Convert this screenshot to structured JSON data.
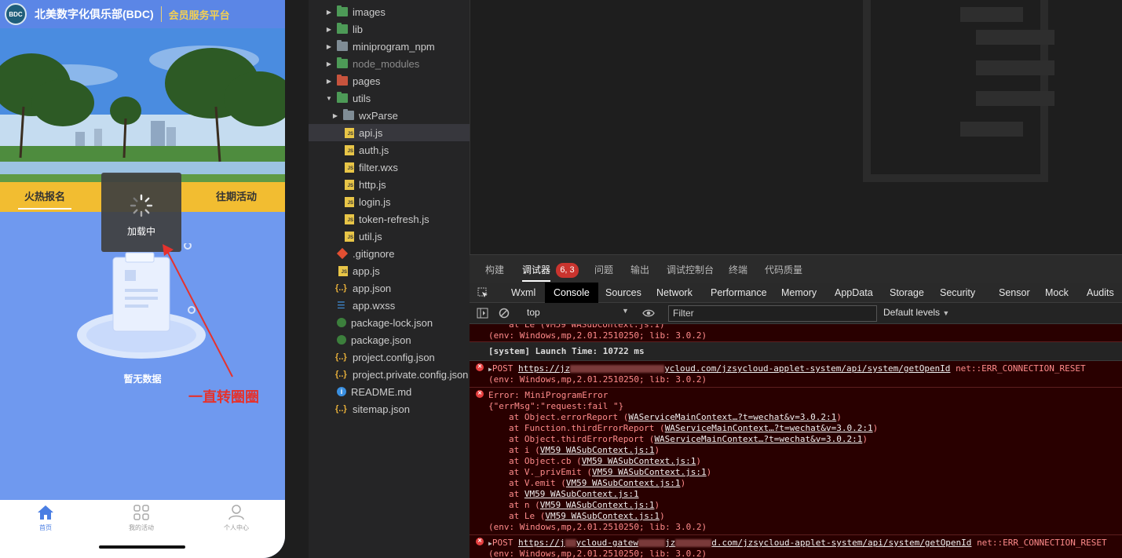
{
  "phone": {
    "logo_text": "BDC",
    "title": "北美数字化俱乐部(BDC)",
    "subtitle": "会员服务平台",
    "tabs": [
      "火热报名",
      "往期活动"
    ],
    "loading_text": "加载中",
    "empty_text": "暂无数据",
    "annotation": "一直转圈圈",
    "tabbar": [
      {
        "label": "首页",
        "icon": "home-icon"
      },
      {
        "label": "我的活动",
        "icon": "grid-icon"
      },
      {
        "label": "个人中心",
        "icon": "person-icon"
      }
    ]
  },
  "file_tree": [
    {
      "label": "images",
      "type": "folder",
      "icon": "image-folder-icon",
      "expanded": false
    },
    {
      "label": "lib",
      "type": "folder",
      "icon": "lib-folder-icon",
      "expanded": false
    },
    {
      "label": "miniprogram_npm",
      "type": "folder",
      "icon": "folder-icon",
      "expanded": false
    },
    {
      "label": "node_modules",
      "type": "folder",
      "icon": "node-folder-icon",
      "expanded": false
    },
    {
      "label": "pages",
      "type": "folder",
      "icon": "pages-folder-icon",
      "expanded": false
    },
    {
      "label": "utils",
      "type": "folder",
      "icon": "utils-folder-icon",
      "expanded": true
    },
    {
      "label": "wxParse",
      "type": "folder",
      "icon": "folder-icon",
      "expanded": false
    },
    {
      "label": "api.js",
      "type": "js",
      "selected": true
    },
    {
      "label": "auth.js",
      "type": "js"
    },
    {
      "label": "filter.wxs",
      "type": "js"
    },
    {
      "label": "http.js",
      "type": "js"
    },
    {
      "label": "login.js",
      "type": "js"
    },
    {
      "label": "token-refresh.js",
      "type": "js"
    },
    {
      "label": "util.js",
      "type": "js"
    },
    {
      "label": ".gitignore",
      "type": "git"
    },
    {
      "label": "app.js",
      "type": "js"
    },
    {
      "label": "app.json",
      "type": "json"
    },
    {
      "label": "app.wxss",
      "type": "css"
    },
    {
      "label": "package-lock.json",
      "type": "npm"
    },
    {
      "label": "package.json",
      "type": "npm"
    },
    {
      "label": "project.config.json",
      "type": "json"
    },
    {
      "label": "project.private.config.json",
      "type": "json"
    },
    {
      "label": "README.md",
      "type": "info"
    },
    {
      "label": "sitemap.json",
      "type": "json"
    }
  ],
  "devtools": {
    "top_tabs": [
      "构建",
      "调试器",
      "问题",
      "输出",
      "调试控制台",
      "终端",
      "代码质量"
    ],
    "active_top_tab": "调试器",
    "badge": "6, 3",
    "panel_tabs": [
      "Wxml",
      "Console",
      "Sources",
      "Network",
      "Performance",
      "Memory",
      "AppData",
      "Storage",
      "Security",
      "Sensor",
      "Mock",
      "Audits"
    ],
    "active_panel_tab": "Console",
    "context": "top",
    "filter_placeholder": "Filter",
    "levels": "Default levels"
  },
  "console": {
    "msg1_partial": "at Le (VM59 WASubContext.js:1)",
    "msg1_env": "(env: Windows,mp,2.01.2510250; lib: 3.0.2)",
    "system": "[system] Launch Time: 10722 ms",
    "post1_prefix": "POST",
    "post1_url_a": "https://jz",
    "post1_url_b": "ycloud.com/jzsycloud-applet-system/api/system/getOpenId",
    "post1_err": "net::ERR_CONNECTION_RESET",
    "post1_env": "(env: Windows,mp,2.01.2510250; lib: 3.0.2)",
    "error_title": "Error: MiniProgramError",
    "error_msg": "{\"errMsg\":\"request:fail \"}",
    "stack": [
      {
        "prefix": "at Object.errorReport (",
        "link": "WASubContext…?t=wechat&v=3.0.2:1",
        "link_prefix": "WAServiceMainContext…?t=wechat&v=3.0.2:1",
        "suffix": ")"
      },
      {
        "prefix": "at Function.thirdErrorReport (",
        "link_prefix": "WAServiceMainContext…?t=wechat&v=3.0.2:1",
        "suffix": ")"
      },
      {
        "prefix": "at Object.thirdErrorReport (",
        "link_prefix": "WAServiceMainContext…?t=wechat&v=3.0.2:1",
        "suffix": ")"
      },
      {
        "prefix": "at i (",
        "link_prefix": "VM59 WASubContext.js:1",
        "suffix": ")"
      },
      {
        "prefix": "at Object.cb (",
        "link_prefix": "VM59 WASubContext.js:1",
        "suffix": ")"
      },
      {
        "prefix": "at V._privEmit (",
        "link_prefix": "VM59 WASubContext.js:1",
        "suffix": ")"
      },
      {
        "prefix": "at V.emit (",
        "link_prefix": "VM59 WASubContext.js:1",
        "suffix": ")"
      },
      {
        "prefix": "at ",
        "link_prefix": "VM59 WASubContext.js:1",
        "suffix": ""
      },
      {
        "prefix": "at n (",
        "link_prefix": "VM59 WASubContext.js:1",
        "suffix": ")"
      },
      {
        "prefix": "at Le (",
        "link_prefix": "VM59 WASubContext.js:1",
        "suffix": ")"
      }
    ],
    "error_env": "(env: Windows,mp,2.01.2510250; lib: 3.0.2)",
    "post2_prefix": "POST",
    "post2_url_a": "https://j",
    "post2_url_b": "ycloud-gatew",
    "post2_url_c": "jz",
    "post2_url_d": "d.com/jzsycloud-applet-system/api/system/getOpenId",
    "post2_err": "net::ERR_CONNECTION_RESET",
    "post2_env": "(env: Windows,mp,2.01.2510250; lib: 3.0.2)"
  },
  "colors": {
    "phone_bg": "#6f99ef",
    "tab_bar": "#f2bd31",
    "error_bg": "#290000",
    "error_text": "#ff8b8b",
    "annotation": "#e5322d"
  }
}
